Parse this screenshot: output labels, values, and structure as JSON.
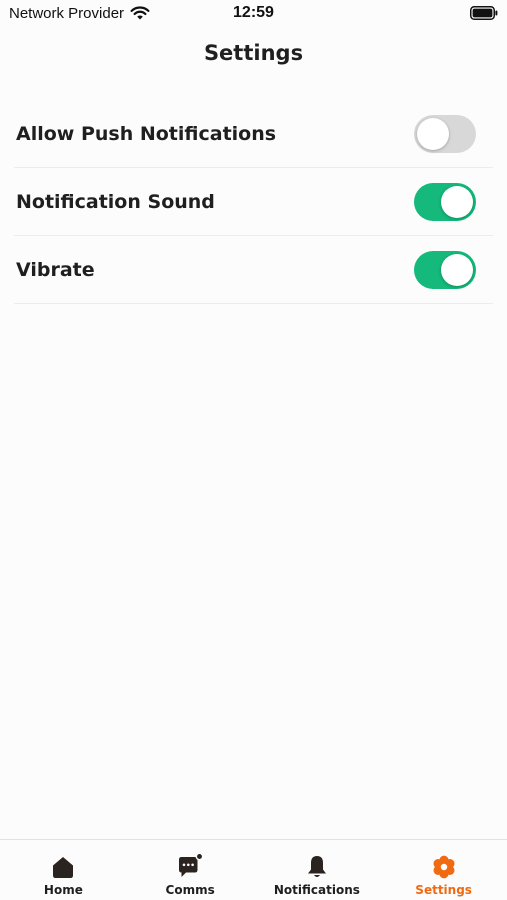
{
  "status_bar": {
    "carrier": "Network Provider",
    "time": "12:59"
  },
  "header": {
    "title": "Settings"
  },
  "settings": [
    {
      "label": "Allow Push Notifications",
      "enabled": false
    },
    {
      "label": "Notification Sound",
      "enabled": true
    },
    {
      "label": "Vibrate",
      "enabled": true
    }
  ],
  "tabs": [
    {
      "label": "Home",
      "icon": "home-icon",
      "active": false
    },
    {
      "label": "Comms",
      "icon": "chat-icon",
      "active": false
    },
    {
      "label": "Notifications",
      "icon": "bell-icon",
      "active": false
    },
    {
      "label": "Settings",
      "icon": "gear-icon",
      "active": true
    }
  ],
  "colors": {
    "toggle_on": "#14b97b",
    "toggle_off": "#d8d8d8",
    "active_tab": "#f06a12",
    "text": "#1f1f1f"
  }
}
